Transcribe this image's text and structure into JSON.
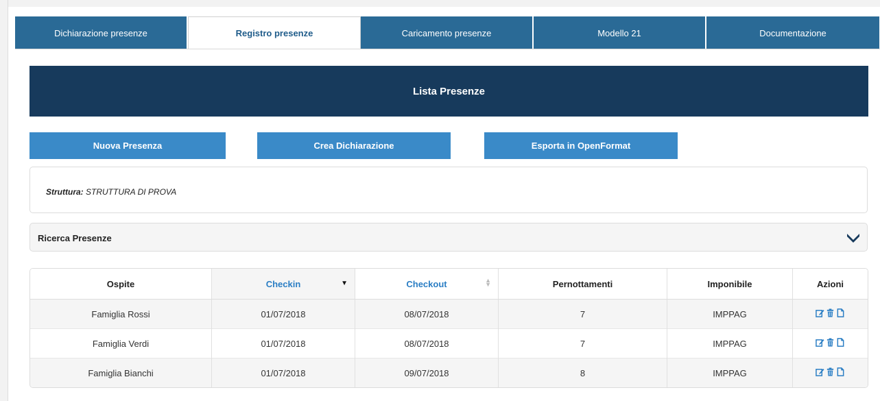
{
  "tabs": [
    {
      "label": "Dichiarazione presenze",
      "active": false
    },
    {
      "label": "Registro presenze",
      "active": true
    },
    {
      "label": "Caricamento presenze",
      "active": false
    },
    {
      "label": "Modello 21",
      "active": false
    },
    {
      "label": "Documentazione",
      "active": false
    }
  ],
  "panel": {
    "title": "Lista Presenze"
  },
  "actions": {
    "nuova": "Nuova Presenza",
    "crea": "Crea Dichiarazione",
    "esporta": "Esporta in OpenFormat"
  },
  "struttura": {
    "label": "Struttura:",
    "value": "STRUTTURA DI PROVA"
  },
  "ricerca": {
    "title": "Ricerca Presenze",
    "icon": "chevron-down-icon"
  },
  "table": {
    "headers": {
      "ospite": "Ospite",
      "checkin": "Checkin",
      "checkout": "Checkout",
      "pernottamenti": "Pernottamenti",
      "imponibile": "Imponibile",
      "azioni": "Azioni"
    },
    "sort": {
      "column": "checkin",
      "direction": "desc"
    },
    "rows": [
      {
        "ospite": "Famiglia Rossi",
        "checkin": "01/07/2018",
        "checkout": "08/07/2018",
        "pernottamenti": "7",
        "imponibile": "IMPPAG"
      },
      {
        "ospite": "Famiglia Verdi",
        "checkin": "01/07/2018",
        "checkout": "08/07/2018",
        "pernottamenti": "7",
        "imponibile": "IMPPAG"
      },
      {
        "ospite": "Famiglia Bianchi",
        "checkin": "01/07/2018",
        "checkout": "09/07/2018",
        "pernottamenti": "8",
        "imponibile": "IMPPAG"
      }
    ],
    "row_action_icons": [
      "edit-icon",
      "trash-icon",
      "document-icon"
    ]
  },
  "colors": {
    "tab_bg": "#2a6a96",
    "header_bg": "#173a5c",
    "button_bg": "#3a8ac8",
    "link_blue": "#2b7ec4",
    "action_icon": "#2b7ec4"
  }
}
